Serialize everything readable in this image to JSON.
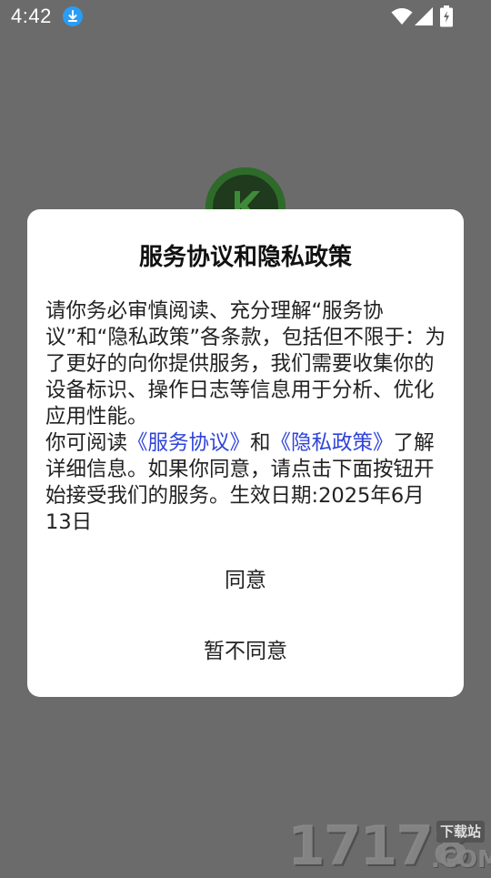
{
  "status_bar": {
    "time": "4:42",
    "icons": [
      "download-icon",
      "wifi-icon",
      "signal-icon",
      "battery-icon"
    ]
  },
  "background": {
    "logo_icon": "app-logo-icon"
  },
  "dialog": {
    "title": "服务协议和隐私政策",
    "paragraph1": "请你务必审慎阅读、充分理解“服务协议”和“隐私政策”各条款，包括但不限于：为了更好的向你提供服务，我们需要收集你的设备标识、操作日志等信息用于分析、优化应用性能。",
    "paragraph2_prefix": "你可阅读",
    "link_service": "《服务协议》",
    "paragraph2_and": "和",
    "link_privacy": "《隐私政策》",
    "paragraph2_suffix": "了解详细信息。如果你同意，请点击下面按钮开始接受我们的服务。生效日期:2025年6月13日",
    "agree_label": "同意",
    "disagree_label": "暂不同意"
  },
  "watermark": {
    "digits": "17178",
    "domain": ".COM",
    "tag": "下载站"
  },
  "colors": {
    "overlay": "#6b6b6b",
    "dialog_bg": "#ffffff",
    "link": "#2f43d8",
    "logo_green": "#2e6b2a"
  }
}
